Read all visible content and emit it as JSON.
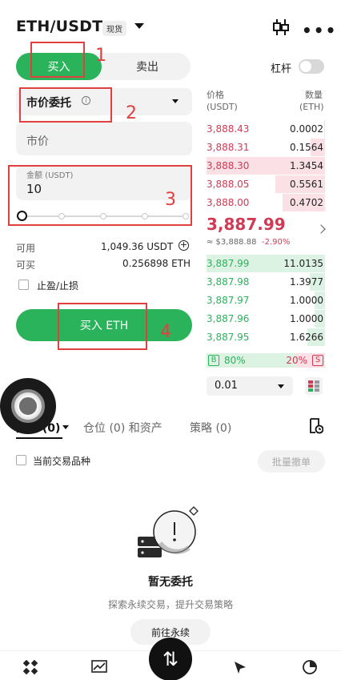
{
  "header": {
    "pair": "ETH/USDT",
    "market_tag": "现货"
  },
  "trade_side": {
    "buy_label": "买入",
    "sell_label": "卖出",
    "selected": "buy"
  },
  "leverage": {
    "label": "杠杆",
    "enabled": false
  },
  "order_form": {
    "order_type": "市价委托",
    "info_glyph": "i",
    "price_text": "市价",
    "amount_label": "金额 (USDT)",
    "amount_value": "10",
    "slider_percent": 0,
    "available_label": "可用",
    "available_value": "1,049.36 USDT",
    "buyable_label": "可买",
    "buyable_value": "0.256898 ETH",
    "tp_sl_label": "止盈/止损",
    "tp_sl_checked": false,
    "submit_label": "买入 ETH"
  },
  "order_book": {
    "price_header": "价格",
    "price_unit": "(USDT)",
    "qty_header": "数量",
    "qty_unit": "(ETH)",
    "asks": [
      {
        "price": "3,888.43",
        "qty": "0.0002",
        "depth": 0.01
      },
      {
        "price": "3,888.31",
        "qty": "0.1564",
        "depth": 0.12
      },
      {
        "price": "3,888.30",
        "qty": "1.3454",
        "depth": 1.0
      },
      {
        "price": "3,888.05",
        "qty": "0.5561",
        "depth": 0.42
      },
      {
        "price": "3,888.00",
        "qty": "0.4702",
        "depth": 0.36
      }
    ],
    "last_price": "3,887.99",
    "usd_price": "≈ $3,888.88",
    "change": "-2.90%",
    "bids": [
      {
        "price": "3,887.99",
        "qty": "11.0135",
        "depth": 1.0
      },
      {
        "price": "3,887.98",
        "qty": "1.3977",
        "depth": 0.13
      },
      {
        "price": "3,887.97",
        "qty": "1.0000",
        "depth": 0.09
      },
      {
        "price": "3,887.96",
        "qty": "1.0000",
        "depth": 0.09
      },
      {
        "price": "3,887.95",
        "qty": "1.6266",
        "depth": 0.15
      }
    ],
    "buy_badge": "B",
    "buy_ratio": "80%",
    "sell_ratio": "20%",
    "sell_badge": "S",
    "depth_step": "0.01"
  },
  "orders_panel": {
    "tabs": [
      "委托 (0)",
      "仓位 (0) 和资产",
      "策略 (0)"
    ],
    "active_tab": 0,
    "current_pair_only_label": "当前交易品种",
    "batch_cancel_label": "批量撤单",
    "empty_title": "暂无委托",
    "empty_subtitle": "探索永续交易，提升交易策略",
    "goto_label": "前往永续"
  },
  "annotations": [
    "1",
    "2",
    "3",
    "4"
  ],
  "colors": {
    "buy_green": "#2bb35c",
    "sell_red": "#d03a55",
    "annotation_red": "#e04040"
  },
  "icons": {
    "header": [
      "candlestick-icon",
      "more-icon"
    ],
    "nav": [
      "grid-icon",
      "chart-icon",
      "swap-icon",
      "compass-icon",
      "pie-chart-icon"
    ]
  }
}
